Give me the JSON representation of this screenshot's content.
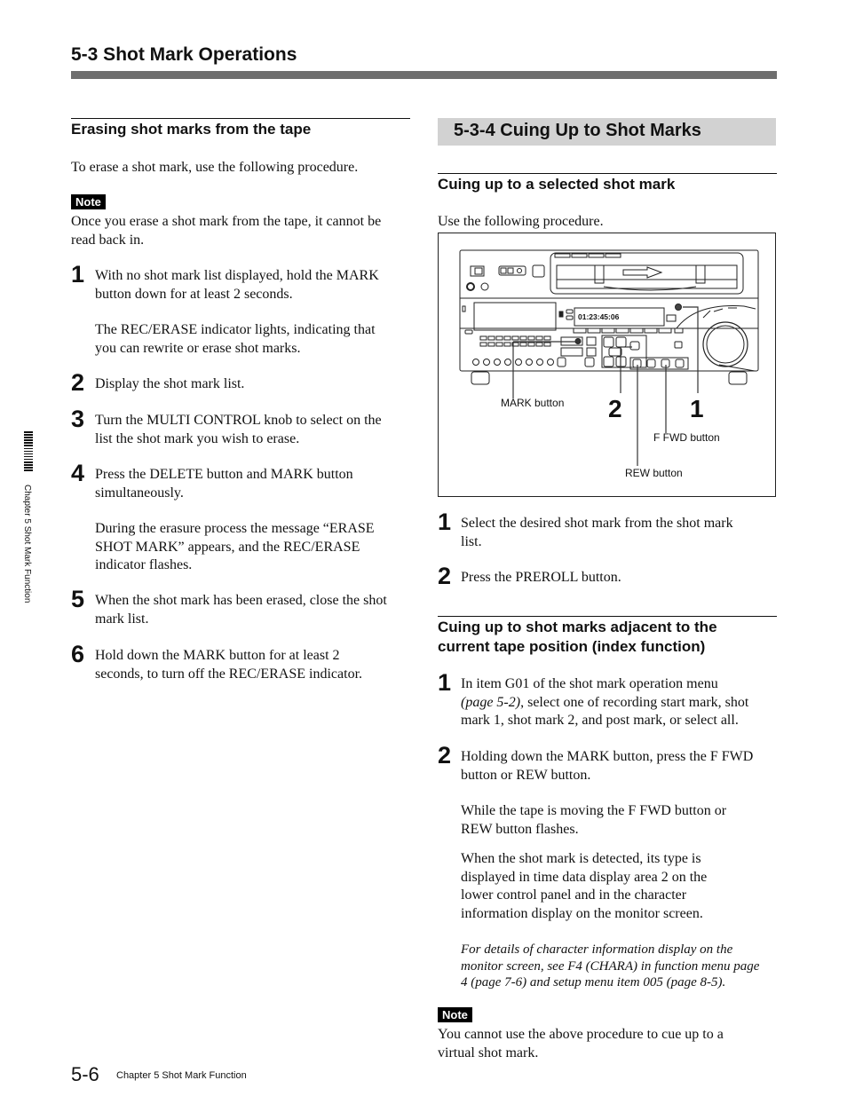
{
  "header": {
    "section_title": "5-3  Shot Mark Operations"
  },
  "left": {
    "heading": "Erasing shot marks from the tape",
    "intro": "To erase a shot mark, use the following procedure.",
    "note_label": "Note",
    "note_text_1": "Once you erase a shot mark from the tape, it cannot be",
    "note_text_2": "read back in.",
    "steps": [
      {
        "num": "1",
        "lines": [
          "With no shot mark list displayed, hold the MARK",
          "button down for at least 2 seconds."
        ],
        "extra": [
          "The REC/ERASE indicator lights, indicating that",
          "you can rewrite or erase shot marks."
        ]
      },
      {
        "num": "2",
        "lines": [
          "Display the shot mark list."
        ]
      },
      {
        "num": "3",
        "lines": [
          "Turn the MULTI CONTROL knob to select on the",
          "list the shot mark you wish to erase."
        ]
      },
      {
        "num": "4",
        "lines": [
          "Press the DELETE button and MARK button",
          "simultaneously."
        ],
        "extra": [
          "During the erasure process the message “ERASE",
          "SHOT MARK” appears, and the REC/ERASE",
          "indicator flashes."
        ]
      },
      {
        "num": "5",
        "lines": [
          "When the shot mark has been erased, close the shot",
          "mark list."
        ]
      },
      {
        "num": "6",
        "lines": [
          "Hold down the MARK button for at least 2",
          "seconds, to turn off the REC/ERASE indicator."
        ]
      }
    ]
  },
  "right": {
    "section_heading": "5-3-4  Cuing Up to Shot Marks",
    "sub1": {
      "heading": "Cuing up to a selected shot mark",
      "intro": "Use the following procedure.",
      "figure": {
        "timecode": "01:23:45:06",
        "labels": {
          "mark": "MARK button",
          "ffwd": "F FWD button",
          "rew": "REW button",
          "callout_2": "2",
          "callout_1": "1"
        }
      },
      "steps": [
        {
          "num": "1",
          "lines": [
            "Select the desired shot mark from the shot mark",
            "list."
          ]
        },
        {
          "num": "2",
          "lines": [
            "Press the PREROLL button."
          ]
        }
      ]
    },
    "sub2": {
      "heading_1": "Cuing up to shot marks adjacent to the",
      "heading_2": "current tape position (index function)",
      "step1": {
        "num": "1",
        "line1": "In item G01 of the shot mark operation menu",
        "line2_italic": "(page 5-2)",
        "line2_rest": ", select one of recording start mark, shot",
        "line3": "mark 1, shot mark 2, and post mark, or select all."
      },
      "step2": {
        "num": "2",
        "lines": [
          "Holding down the MARK button, press the F FWD",
          "button or REW button."
        ],
        "para2": [
          "While the tape is moving the F FWD button or",
          "REW button flashes."
        ],
        "para3": [
          "When the shot mark is detected, its type is",
          "displayed in time data display area 2 on the",
          "lower control panel and in the character",
          "information display on the monitor screen."
        ],
        "ref": [
          "For details of character information display on the",
          "monitor screen, see F4 (CHARA) in function menu page",
          "4 (page 7-6) and setup menu item 005 (page 8-5)."
        ]
      },
      "note_label": "Note",
      "note_lines": [
        "You cannot use the above procedure to cue up to a",
        "virtual shot mark."
      ]
    }
  },
  "side_tab": {
    "text": "Chapter 5   Shot Mark Function"
  },
  "footer": {
    "page_number": "5-6",
    "chapter_text": "Chapter 5    Shot Mark Function"
  }
}
